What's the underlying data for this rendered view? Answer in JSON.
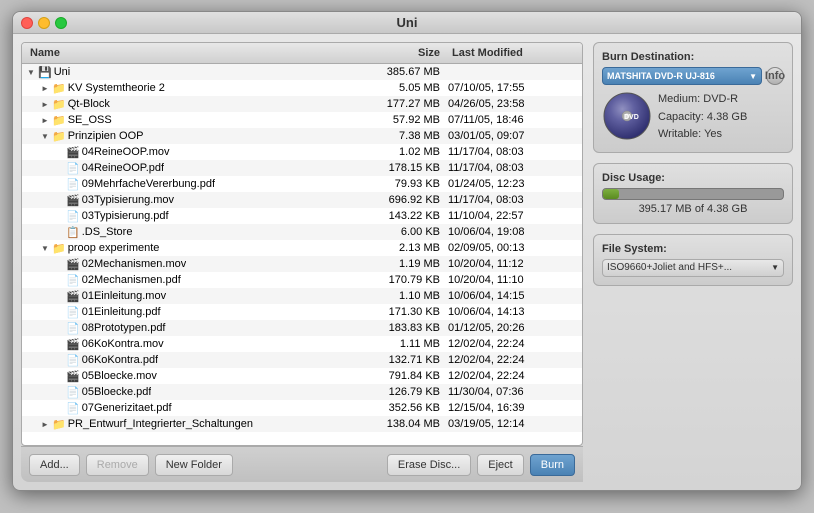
{
  "window": {
    "title": "Uni"
  },
  "header": {
    "name_col": "Name",
    "size_col": "Size",
    "modified_col": "Last Modified"
  },
  "files": [
    {
      "level": 0,
      "type": "disc",
      "expanded": true,
      "name": "Uni",
      "size": "385.67 MB",
      "modified": "",
      "selected": false
    },
    {
      "level": 1,
      "type": "folder",
      "expanded": false,
      "name": "KV Systemtheorie 2",
      "size": "5.05 MB",
      "modified": "07/10/05, 17:55",
      "selected": false
    },
    {
      "level": 1,
      "type": "folder",
      "expanded": false,
      "name": "Qt-Block",
      "size": "177.27 MB",
      "modified": "04/26/05, 23:58",
      "selected": false
    },
    {
      "level": 1,
      "type": "folder",
      "expanded": false,
      "name": "SE_OSS",
      "size": "57.92 MB",
      "modified": "07/11/05, 18:46",
      "selected": false
    },
    {
      "level": 1,
      "type": "folder",
      "expanded": true,
      "name": "Prinzipien OOP",
      "size": "7.38 MB",
      "modified": "03/01/05, 09:07",
      "selected": false
    },
    {
      "level": 2,
      "type": "mov",
      "expanded": false,
      "name": "04ReineOOP.mov",
      "size": "1.02 MB",
      "modified": "11/17/04, 08:03",
      "selected": false
    },
    {
      "level": 2,
      "type": "pdf",
      "expanded": false,
      "name": "04ReineOOP.pdf",
      "size": "178.15 KB",
      "modified": "11/17/04, 08:03",
      "selected": false
    },
    {
      "level": 2,
      "type": "pdf",
      "expanded": false,
      "name": "09MehrfacheVererbung.pdf",
      "size": "79.93 KB",
      "modified": "01/24/05, 12:23",
      "selected": false
    },
    {
      "level": 2,
      "type": "mov",
      "expanded": false,
      "name": "03Typisierung.mov",
      "size": "696.92 KB",
      "modified": "11/17/04, 08:03",
      "selected": false
    },
    {
      "level": 2,
      "type": "pdf",
      "expanded": false,
      "name": "03Typisierung.pdf",
      "size": "143.22 KB",
      "modified": "11/10/04, 22:57",
      "selected": false
    },
    {
      "level": 2,
      "type": "file",
      "expanded": false,
      "name": ".DS_Store",
      "size": "6.00 KB",
      "modified": "10/06/04, 19:08",
      "selected": false
    },
    {
      "level": 1,
      "type": "folder",
      "expanded": true,
      "name": "proop experimente",
      "size": "2.13 MB",
      "modified": "02/09/05, 00:13",
      "selected": false
    },
    {
      "level": 2,
      "type": "mov",
      "expanded": false,
      "name": "02Mechanismen.mov",
      "size": "1.19 MB",
      "modified": "10/20/04, 11:12",
      "selected": false
    },
    {
      "level": 2,
      "type": "pdf",
      "expanded": false,
      "name": "02Mechanismen.pdf",
      "size": "170.79 KB",
      "modified": "10/20/04, 11:10",
      "selected": false
    },
    {
      "level": 2,
      "type": "mov",
      "expanded": false,
      "name": "01Einleitung.mov",
      "size": "1.10 MB",
      "modified": "10/06/04, 14:15",
      "selected": false
    },
    {
      "level": 2,
      "type": "pdf",
      "expanded": false,
      "name": "01Einleitung.pdf",
      "size": "171.30 KB",
      "modified": "10/06/04, 14:13",
      "selected": false
    },
    {
      "level": 2,
      "type": "pdf",
      "expanded": false,
      "name": "08Prototypen.pdf",
      "size": "183.83 KB",
      "modified": "01/12/05, 20:26",
      "selected": false
    },
    {
      "level": 2,
      "type": "mov",
      "expanded": false,
      "name": "06KoKontra.mov",
      "size": "1.11 MB",
      "modified": "12/02/04, 22:24",
      "selected": false
    },
    {
      "level": 2,
      "type": "pdf",
      "expanded": false,
      "name": "06KoKontra.pdf",
      "size": "132.71 KB",
      "modified": "12/02/04, 22:24",
      "selected": false
    },
    {
      "level": 2,
      "type": "mov",
      "expanded": false,
      "name": "05Bloecke.mov",
      "size": "791.84 KB",
      "modified": "12/02/04, 22:24",
      "selected": false
    },
    {
      "level": 2,
      "type": "pdf",
      "expanded": false,
      "name": "05Bloecke.pdf",
      "size": "126.79 KB",
      "modified": "11/30/04, 07:36",
      "selected": false
    },
    {
      "level": 2,
      "type": "pdf",
      "expanded": false,
      "name": "07Generizitaet.pdf",
      "size": "352.56 KB",
      "modified": "12/15/04, 16:39",
      "selected": false
    },
    {
      "level": 1,
      "type": "folder",
      "expanded": false,
      "name": "PR_Entwurf_Integrierter_Schaltungen",
      "size": "138.04 MB",
      "modified": "03/19/05, 12:14",
      "selected": false
    }
  ],
  "buttons": {
    "add": "Add...",
    "remove": "Remove",
    "new_folder": "New Folder",
    "erase_disc": "Erase Disc...",
    "eject": "Eject",
    "burn": "Burn"
  },
  "burn_destination": {
    "label": "Burn Destination:",
    "drive": "MATSHITA DVD-R UJ-816",
    "info_btn": "Info",
    "medium_label": "Medium:",
    "medium_value": "DVD-R",
    "capacity_label": "Capacity:",
    "capacity_value": "4.38 GB",
    "writable_label": "Writable:",
    "writable_value": "Yes"
  },
  "disc_usage": {
    "label": "Disc Usage:",
    "used": "395.17 MB",
    "total": "4.38 GB",
    "text": "395.17 MB of 4.38 GB",
    "percent": 9
  },
  "file_system": {
    "label": "File System:",
    "value": "ISO9660+Joliet and HFS+..."
  }
}
